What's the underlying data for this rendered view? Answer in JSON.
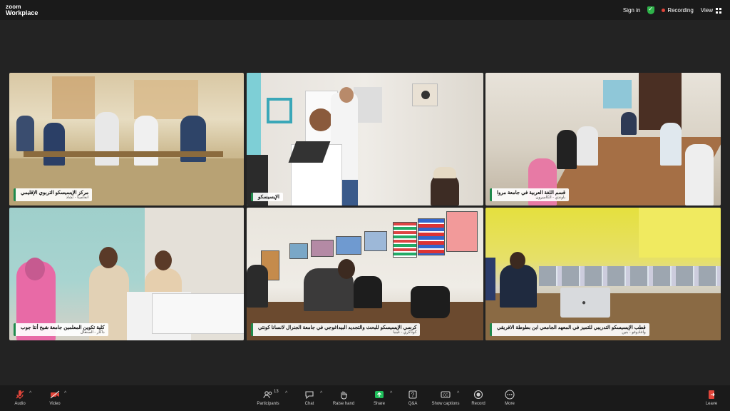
{
  "app": {
    "brand_top": "zoom",
    "brand_bottom": "Workplace"
  },
  "topbar": {
    "sign_in": "Sign in",
    "recording": "Recording",
    "view": "View"
  },
  "tiles": [
    {
      "id": "t1",
      "name": "مركز الإيسيسكو التربوي الإقليمي",
      "sub": "انجامينا - تشاد",
      "active": false
    },
    {
      "id": "t2",
      "name": "الإيسيسكو",
      "sub": "",
      "active": true
    },
    {
      "id": "t3",
      "name": "قسم اللغة العربية في جامعة مروا",
      "sub": "باوندي - الكاميرون",
      "active": false
    },
    {
      "id": "t4",
      "name": "كلية تكوين المعلمين جامعة شيخ أنتا جوب",
      "sub": "داكار - السنغال",
      "active": false
    },
    {
      "id": "t5",
      "name": "كرسي الإيسيسكو للبحث والتجديد البيداغوجي في جامعة الجنرال لانسانا كونتي",
      "sub": "كوناكري - غينيا",
      "active": false
    },
    {
      "id": "t6",
      "name": "قطب الإيسيسكو التدريبي للتميز في المعهد الجامعي ابن بطوطة الافريقي",
      "sub": "واغادوغو - بنين",
      "active": false
    }
  ],
  "toolbar": {
    "audio": "Audio",
    "video": "Video",
    "participants": "Participants",
    "participants_count": "13",
    "chat": "Chat",
    "raise_hand": "Raise hand",
    "share": "Share",
    "qa": "Q&A",
    "captions": "Show captions",
    "record": "Record",
    "more": "More",
    "leave": "Leave"
  },
  "colors": {
    "active_border": "#2fbf71",
    "share_green": "#1fbf5b",
    "leave_red": "#e0453a",
    "mute_red": "#e0453a"
  }
}
